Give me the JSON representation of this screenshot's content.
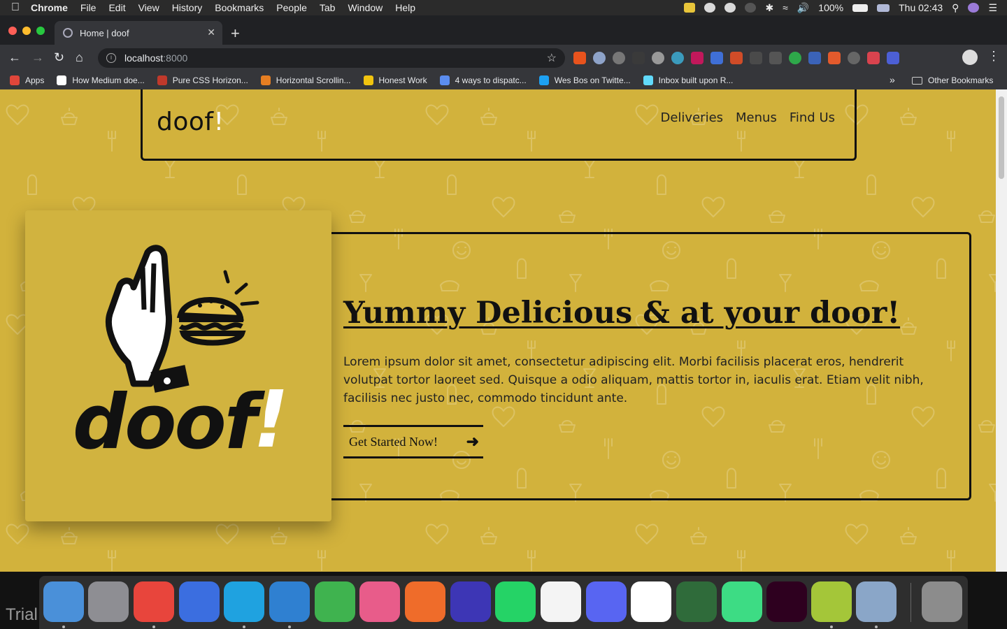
{
  "menubar": {
    "app": "Chrome",
    "items": [
      "File",
      "Edit",
      "View",
      "History",
      "Bookmarks",
      "People",
      "Tab",
      "Window",
      "Help"
    ],
    "battery": "100%",
    "clock": "Thu 02:43"
  },
  "tab": {
    "title": "Home | doof"
  },
  "address": {
    "host": "localhost",
    "port": ":8000"
  },
  "bookmarks": [
    {
      "label": "Apps",
      "color": "#e0463a"
    },
    {
      "label": "How Medium doe...",
      "color": "#ffffff"
    },
    {
      "label": "Pure CSS Horizon...",
      "color": "#c0392b"
    },
    {
      "label": "Horizontal Scrollin...",
      "color": "#e67e22"
    },
    {
      "label": "Honest Work",
      "color": "#f1c40f"
    },
    {
      "label": "4 ways to dispatc...",
      "color": "#5b8def"
    },
    {
      "label": "Wes Bos on Twitte...",
      "color": "#1da1f2"
    },
    {
      "label": "Inbox built upon R...",
      "color": "#61dafb"
    }
  ],
  "other_bookmarks": "Other Bookmarks",
  "site": {
    "logo": "doof",
    "logo_bang": "!",
    "nav": [
      "Deliveries",
      "Menus",
      "Find Us"
    ],
    "hero_title": "Yummy Delicious & at your door!",
    "hero_text": "Lorem ipsum dolor sit amet, consectetur adipiscing elit. Morbi facilisis placerat eros, hendrerit volutpat tortor laoreet sed. Quisque a odio aliquam, mattis tortor in, iaculis erat. Etiam velit nibh, facilisis nec justo nec, commodo tincidunt ante.",
    "cta": "Get Started Now!",
    "brand_mark_text": "doof",
    "brand_mark_bang": "!"
  },
  "dock": {
    "trial": "Trial",
    "apps": [
      {
        "name": "finder",
        "color": "#4a90d9"
      },
      {
        "name": "launchpad",
        "color": "#8e8e93"
      },
      {
        "name": "chrome",
        "color": "#e8453c"
      },
      {
        "name": "firefox",
        "color": "#3b6ee0"
      },
      {
        "name": "webstorm",
        "color": "#1fa2e0"
      },
      {
        "name": "vscode",
        "color": "#2f80d1"
      },
      {
        "name": "evernote",
        "color": "#3fb34f"
      },
      {
        "name": "itunes",
        "color": "#e85c8a"
      },
      {
        "name": "postman",
        "color": "#ef6c2a"
      },
      {
        "name": "app-purple",
        "color": "#3d36b5"
      },
      {
        "name": "whatsapp",
        "color": "#25d366"
      },
      {
        "name": "slack",
        "color": "#f4f4f4"
      },
      {
        "name": "discord",
        "color": "#5865f2"
      },
      {
        "name": "mongodb",
        "color": "#ffffff"
      },
      {
        "name": "app-green-ring",
        "color": "#2f6b3a"
      },
      {
        "name": "android-studio",
        "color": "#3ddc84"
      },
      {
        "name": "adobe-xd",
        "color": "#2e001f"
      },
      {
        "name": "android",
        "color": "#a4c639"
      },
      {
        "name": "preview",
        "color": "#8aa6c8"
      },
      {
        "name": "trash",
        "color": "#8c8c8c"
      }
    ]
  },
  "colors": {
    "page_bg": "#d2b23c",
    "ink": "#111111"
  }
}
